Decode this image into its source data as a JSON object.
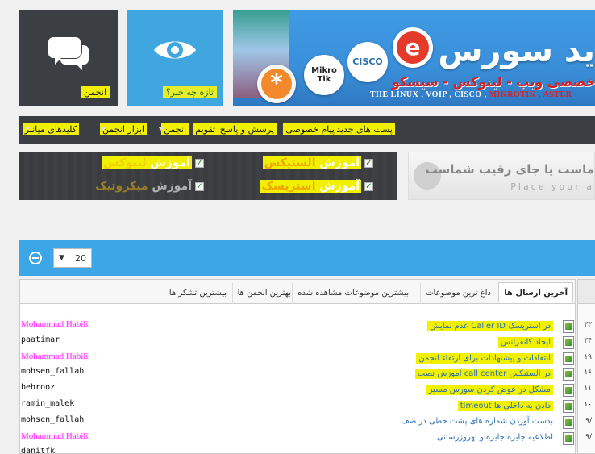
{
  "tiles": {
    "forum_label": "انجمن",
    "news_label": "تازه چه خبر؟"
  },
  "banner": {
    "title": "ید سورس",
    "subtitle": "خصصی ویپ - لینوکس - سیسکو",
    "slogan_main": "THE LINUX , VOIP , CISCO , ",
    "slogan_red": "MIKROTIK",
    "slogan_end": " , ASTER",
    "logo_mikrotik": "Mikro Tik",
    "logo_cisco": "CISCO",
    "logo_asterisk": "*",
    "logo_e": "e"
  },
  "menu": {
    "items": [
      {
        "label": "پست های جدید"
      },
      {
        "label": "پیام خصوصی"
      },
      {
        "label": "پرسش و پاسخ"
      },
      {
        "label": "تقویم"
      },
      {
        "label": "انجمن"
      },
      {
        "label": "ابزار انجمن"
      },
      {
        "label": "کلیدهای میانبر"
      }
    ]
  },
  "promo": {
    "row1_a_prefix": "آموزش ",
    "row1_a_hl": "الستیکس",
    "row1_b_prefix": "آموزش ",
    "row1_b_hl": "لینوکس",
    "row2_a_prefix": "آموزش ",
    "row2_a_hl": "استریسک",
    "row2_b_prefix": "آموزش ",
    "row2_b_hl": "میکروتیک"
  },
  "ad": {
    "line1": "ماست یا جای رقیب شماست",
    "line2": "Place your a"
  },
  "widget": {
    "per_page": "20"
  },
  "tabs": [
    {
      "label": "آخرین ارسال ها"
    },
    {
      "label": "داغ ترین موضوعات"
    },
    {
      "label": "بیشترین موضوعات مشاهده شده"
    },
    {
      "label": "بهترین انجمن ها"
    },
    {
      "label": "بیشترین تشکر ها"
    }
  ],
  "rows": [
    {
      "user": "Mohammad Habili",
      "user_hl": true,
      "topic": "عدم نمایش Caller ID در استریسک",
      "topic_hl": true,
      "count": "۳۳"
    },
    {
      "user": "paatimar",
      "user_hl": false,
      "topic": "ایجاد کانفرانس",
      "topic_hl": true,
      "count": "۳۴"
    },
    {
      "user": "Mohammad Habili",
      "user_hl": true,
      "topic": "انتقادات و پیشنهادات برای ارتقاء انجمن",
      "topic_hl": true,
      "count": "۱۹"
    },
    {
      "user": "mohsen_fallah",
      "user_hl": false,
      "topic": "آموزش نصب call center در الستیکس",
      "topic_hl": true,
      "count": "۱۶"
    },
    {
      "user": "behrooz",
      "user_hl": false,
      "topic": "مشکل در عوض کردن سورس مسیر",
      "topic_hl": true,
      "count": "۱۱"
    },
    {
      "user": "ramin_malek",
      "user_hl": false,
      "topic": "timeout دادن به داخلی ها",
      "topic_hl": true,
      "count": "۱۰"
    },
    {
      "user": "mohsen_fallah",
      "user_hl": false,
      "topic": "بدست آوردن شماره های پشت خطی در صف",
      "topic_hl": false,
      "count": "۹/"
    },
    {
      "user": "Mohammad Habili",
      "user_hl": true,
      "topic": "اطلاعیه جایزه جایزه و بهروزرسانی",
      "topic_hl": false,
      "count": "۹/"
    },
    {
      "user": "danitfk",
      "user_hl": false,
      "topic": "",
      "topic_hl": false,
      "count": ""
    }
  ]
}
